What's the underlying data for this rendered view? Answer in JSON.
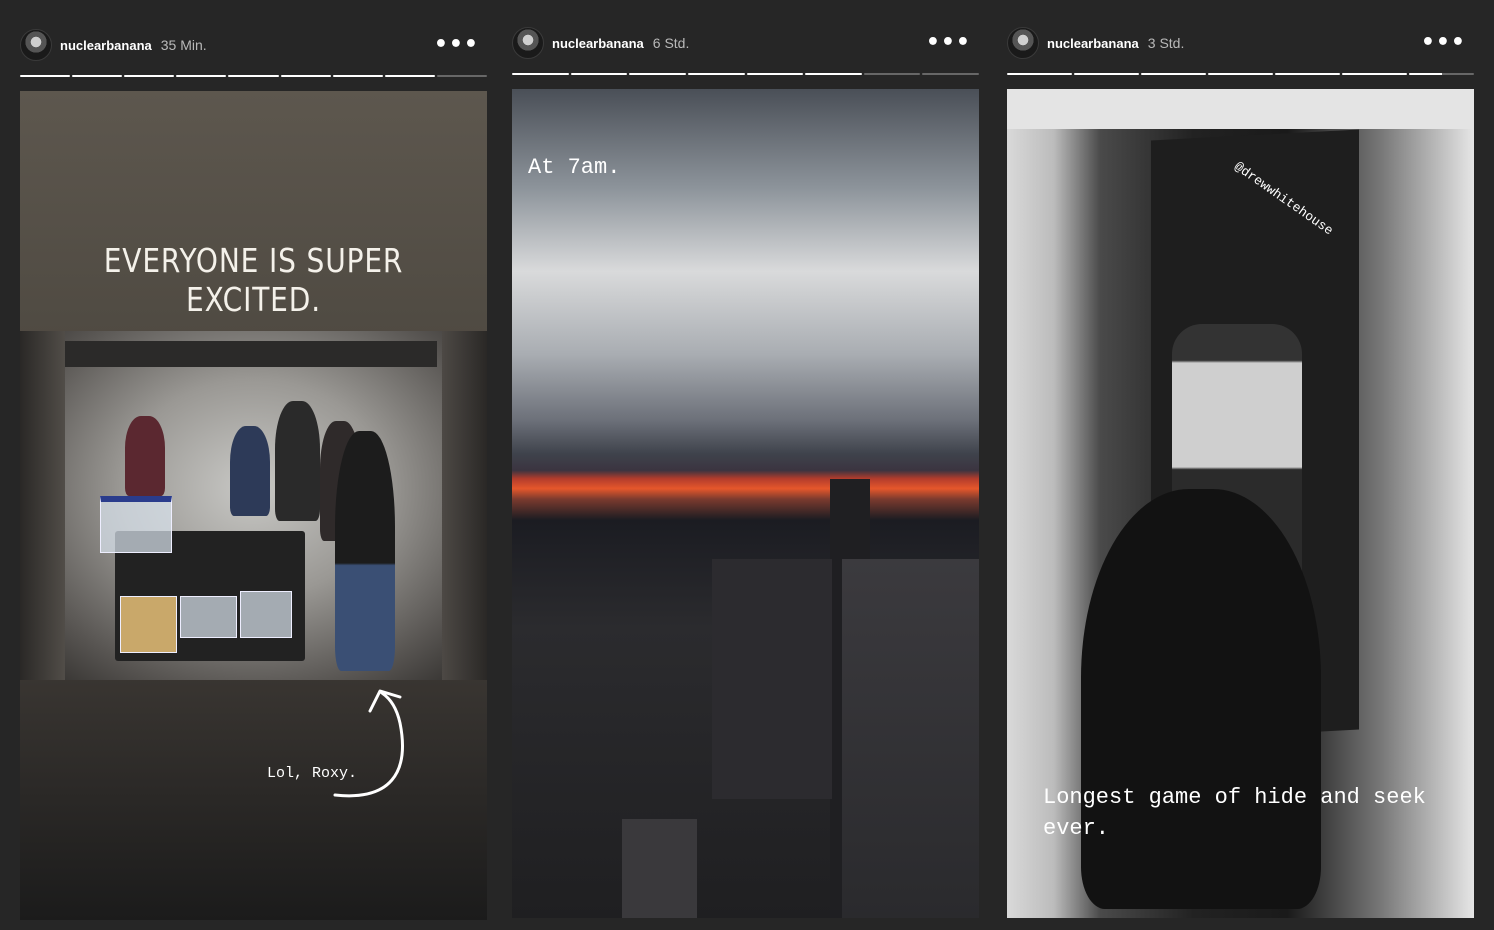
{
  "stories": [
    {
      "username": "nuclearbanana",
      "time": "35 Min.",
      "more_label": "•••",
      "progress": [
        1,
        1,
        1,
        1,
        1,
        1,
        1,
        1,
        0
      ],
      "title": "EVERYONE IS SUPER EXCITED.",
      "caption": "Lol, Roxy."
    },
    {
      "username": "nuclearbanana",
      "time": "6 Std.",
      "more_label": "•••",
      "progress": [
        1,
        1,
        1,
        1,
        1,
        1,
        0,
        0
      ],
      "caption": "At 7am."
    },
    {
      "username": "nuclearbanana",
      "time": "3 Std.",
      "more_label": "•••",
      "progress": [
        1,
        1,
        1,
        1,
        1,
        1,
        0.5
      ],
      "mention": "@drewwhitehouse",
      "caption": "Longest game of hide and seek ever."
    }
  ],
  "colors": {
    "background": "#262626",
    "text": "#ffffff",
    "time": "#b9b9b9"
  }
}
